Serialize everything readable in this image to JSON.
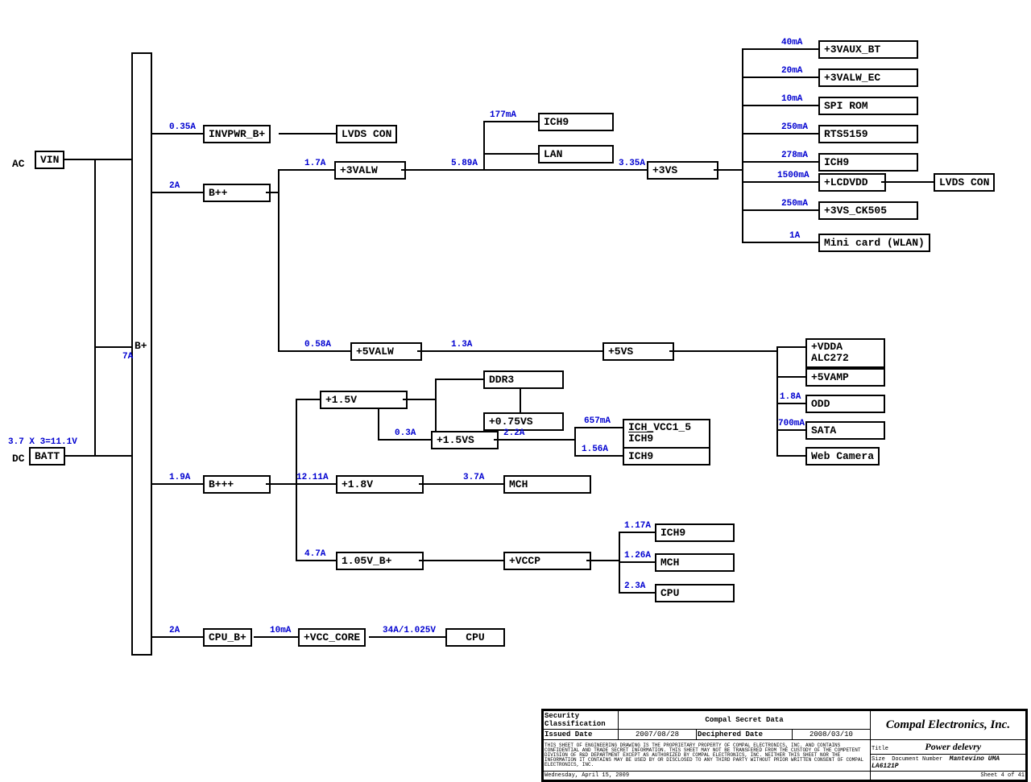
{
  "src": {
    "ac": "AC",
    "vin": "VIN",
    "dc": "DC",
    "batt": "BATT",
    "batt_note": "3.7 X 3=11.1V",
    "seven_a": "7A",
    "bplus": "B+"
  },
  "r1": {
    "i": "0.35A",
    "inv": "INVPWR_B+",
    "lvds": "LVDS CON",
    "i2": "2A",
    "bpp": "B++"
  },
  "valw3": {
    "i": "1.7A",
    "name": "+3VALW",
    "o": "5.89A",
    "ich9_i": "177mA",
    "ich9": "ICH9",
    "lan": "LAN",
    "vs_i": "3.35A",
    "vs": "+3VS"
  },
  "vs3": {
    "a": {
      "i": "40mA",
      "n": "+3VAUX_BT"
    },
    "b": {
      "i": "20mA",
      "n": "+3VALW_EC"
    },
    "c": {
      "i": "10mA",
      "n": "SPI ROM"
    },
    "d": {
      "i": "250mA",
      "n": "RTS5159"
    },
    "e": {
      "i": "278mA",
      "n": "ICH9"
    },
    "f": {
      "i": "1500mA",
      "n": "+LCDVDD"
    },
    "f2": "LVDS CON",
    "g": {
      "i": "250mA",
      "n": "+3VS_CK505"
    },
    "h": {
      "i": "1A",
      "n": "Mini card (WLAN)"
    }
  },
  "valw5": {
    "i": "0.58A",
    "name": "+5VALW",
    "o": "1.3A",
    "vs": "+5VS"
  },
  "vs5": {
    "a": {
      "n1": "+VDDA",
      "n2": "ALC272"
    },
    "b": {
      "n": "+5VAMP"
    },
    "c": {
      "i": "1.8A",
      "n": "ODD"
    },
    "d": {
      "i": "700mA",
      "n": "SATA"
    },
    "e": {
      "n": "Web Camera"
    }
  },
  "bppp": {
    "i": "1.9A",
    "name": "B+++",
    "v15": {
      "i": "",
      "n": "+1.5V"
    },
    "ddr3": "DDR3",
    "v075": "+0.75VS",
    "v15s_i": "0.3A",
    "v15s": "+1.5VS",
    "v15s_o": "2.2A",
    "ich_vcc": {
      "i": "657mA",
      "n1": "ICH_VCC1_5",
      "n2": "ICH9"
    },
    "ich9_b": {
      "i": "1.56A",
      "n": "ICH9"
    },
    "v18": {
      "i": "12.11A",
      "n": "+1.8V",
      "o": "3.7A"
    },
    "mch": "MCH",
    "v105": {
      "i": "4.7A",
      "n": "1.05V_B+"
    },
    "vccp": "+VCCP",
    "vccp_out": {
      "a": {
        "i": "1.17A",
        "n": "ICH9"
      },
      "b": {
        "i": "1.26A",
        "n": "MCH"
      },
      "c": {
        "i": "2.3A",
        "n": "CPU"
      }
    }
  },
  "cpu": {
    "i": "2A",
    "bp": "CPU_B+",
    "core_i": "10mA",
    "core": "+VCC_CORE",
    "out": "34A/1.025V",
    "cpu": "CPU"
  },
  "titleblock": {
    "sec": "Security Classification",
    "csd": "Compal Secret Data",
    "id": "Issued Date",
    "idv": "2007/08/28",
    "dd": "Deciphered Date",
    "ddv": "2008/03/10",
    "legal": "THIS SHEET OF ENGINEERING DRAWING IS THE PROPRIETARY PROPERTY OF COMPAL ELECTRONICS, INC. AND CONTAINS CONFIDENTIAL AND TRADE SECRET INFORMATION. THIS SHEET MAY NOT BE TRANSFERED FROM THE CUSTODY OF THE COMPETENT DIVISION OF R&D DEPARTMENT EXCEPT AS AUTHORIZED BY COMPAL ELECTRONICS, INC. NEITHER THIS SHEET NOR THE INFORMATION IT CONTAINS MAY BE USED BY OR DISCLOSED TO ANY THIRD PARTY WITHOUT PRIOR WRITTEN CONSENT OF COMPAL ELECTRONICS, INC.",
    "company": "Compal Electronics, Inc.",
    "sheet": "Power delevry",
    "doc": "Mantevino UMA LA6121P",
    "title_l": "Title",
    "docnum": "Document Number",
    "size": "Size",
    "date": "Wednesday, April 15, 2009",
    "sheet_num": "Sheet 4 of 41"
  }
}
